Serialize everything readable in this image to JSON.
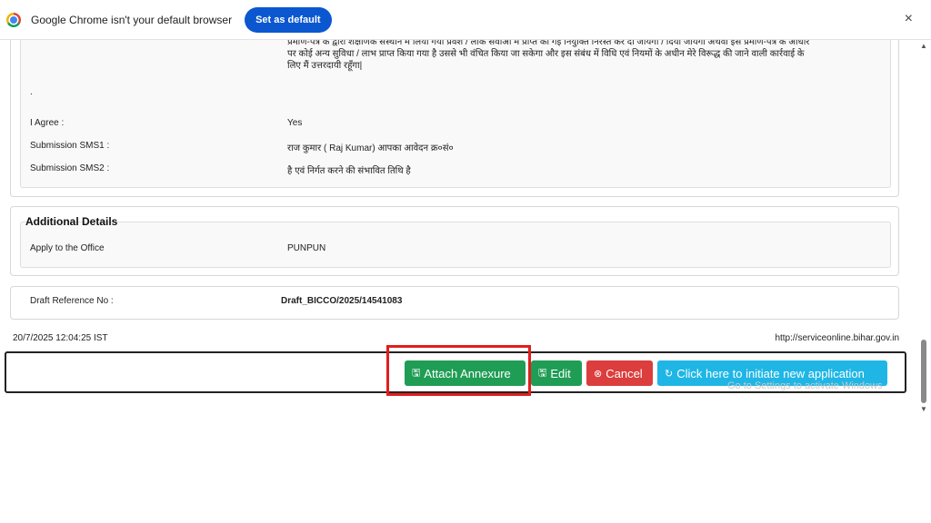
{
  "infobar": {
    "message": "Google Chrome isn't your default browser",
    "set_default_label": "Set as default",
    "close_glyph": "×"
  },
  "declaration": {
    "paragraph": "प्रमाण-पत्र के द्वारा शैक्षणिक संस्थान में लिया गया प्रवेश / लोक सेवाओं में प्राप्त की गई नियुक्ति निरस्त कर दी जायेगी / दिया जायेगा अथवा इस प्रमाण-पत्र के आधार पर कोई अन्य सुविधा / लाभ प्राप्त किया गया है उससे भी वंचित किया जा सकेगा और इस संबंध में विधि एवं नियमों के अधीन मेरे विरूद्ध की जाने वाली कार्रवाई के लिए मैं उत्तरदायी रहूँगा|",
    "dot": ".",
    "rows": [
      {
        "label": "I Agree :",
        "value": "Yes"
      },
      {
        "label": "Submission SMS1 :",
        "value": "राज कुमार ( Raj Kumar) आपका आवेदन क्र०सं०"
      },
      {
        "label": "Submission SMS2 :",
        "value": "है एवं निर्गत करने की संभावित तिथि है"
      }
    ]
  },
  "additional": {
    "title": "Additional Details",
    "label": "Apply to the Office",
    "value": "PUNPUN"
  },
  "draft": {
    "label": "Draft Reference No :",
    "value": "Draft_BICCO/2025/14541083"
  },
  "footer": {
    "timestamp": "20/7/2025 12:04:25 IST",
    "url": "http://serviceonline.bihar.gov.in"
  },
  "actions": {
    "attach": "Attach Annexure",
    "edit": "Edit",
    "cancel": "Cancel",
    "new_application": "Click here to initiate new application"
  },
  "watermark": "Go to Settings to activate Windows",
  "colors": {
    "success": "#1f9d55",
    "danger": "#dc3d3d",
    "info": "#1fb6e6",
    "highlight": "#e21d1d",
    "chrome_blue": "#0b57d0"
  }
}
